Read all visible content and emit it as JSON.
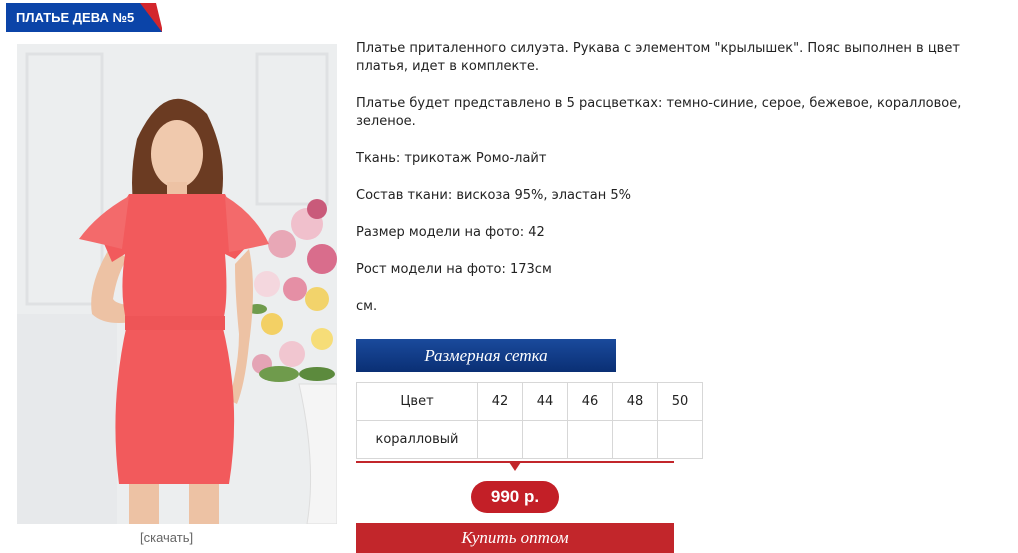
{
  "product": {
    "title": "ПЛАТЬЕ ДЕВА №5",
    "image_alt": "Платье Дева №5",
    "download_label": "[скачать]"
  },
  "description": {
    "p1": "Платье приталенного силуэта. Рукава с элементом \"крылышек\". Пояс выполнен в цвет платья, идет в комплекте.",
    "p2": "Платье будет представлено в 5 расцветках: темно-синие, серое, бежевое, коралловое, зеленое.",
    "p3": "Ткань: трикотаж Ромо-лайт",
    "p4": "Состав ткани: вискоза 95%, эластан 5%",
    "p5": "Размер модели на фото: 42",
    "p6": "Рост модели на фото: 173см",
    "p7": "см."
  },
  "size_grid": {
    "button_label": "Размерная сетка",
    "header": [
      "Цвет",
      "42",
      "44",
      "46",
      "48",
      "50"
    ],
    "rows": [
      [
        "коралловый",
        "",
        "",
        "",
        "",
        ""
      ]
    ]
  },
  "price": {
    "value": "990 р."
  },
  "buy": {
    "label": "Купить оптом"
  },
  "colors": {
    "brand_blue": "#0b44a8",
    "accent_red": "#c31f27",
    "dress_coral": "#f25a5c"
  }
}
